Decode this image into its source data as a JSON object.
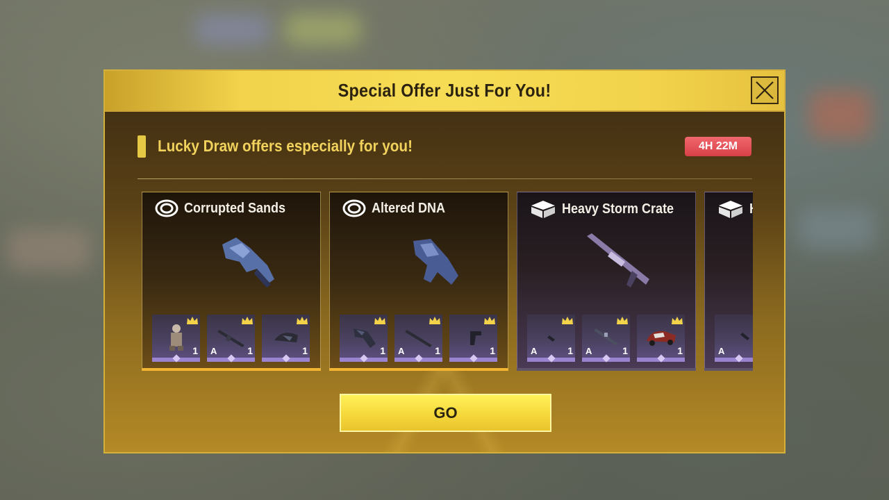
{
  "dialog": {
    "title": "Special Offer Just For You!",
    "subtitle": "Lucky Draw offers especially for you!",
    "timer": "4H 22M",
    "go_label": "GO"
  },
  "cards": [
    {
      "name": "Corrupted Sands",
      "icon": "lucky-draw-ring-icon",
      "theme": "gold",
      "slots": [
        {
          "grade": "",
          "qty": "1",
          "art": "character-outfit"
        },
        {
          "grade": "A",
          "qty": "1",
          "art": "rifle"
        },
        {
          "grade": "",
          "qty": "1",
          "art": "helmet"
        }
      ]
    },
    {
      "name": "Altered DNA",
      "icon": "lucky-draw-ring-icon",
      "theme": "gold",
      "slots": [
        {
          "grade": "",
          "qty": "1",
          "art": "weapon-skin"
        },
        {
          "grade": "A",
          "qty": "1",
          "art": "rifle"
        },
        {
          "grade": "",
          "qty": "1",
          "art": "pistol"
        }
      ]
    },
    {
      "name": "Heavy Storm Crate",
      "icon": "crate-icon",
      "theme": "purple",
      "slots": [
        {
          "grade": "A",
          "qty": "1",
          "art": "charm"
        },
        {
          "grade": "A",
          "qty": "1",
          "art": "rifle"
        },
        {
          "grade": "",
          "qty": "1",
          "art": "vehicle"
        }
      ]
    },
    {
      "name": "H",
      "icon": "crate-icon",
      "theme": "purple",
      "slots": [
        {
          "grade": "A",
          "qty": "",
          "art": "charm"
        }
      ]
    }
  ],
  "colors": {
    "accent_gold": "#f2d34b",
    "timer_red": "#e04a50",
    "slot_purple": "#9a84d0"
  }
}
